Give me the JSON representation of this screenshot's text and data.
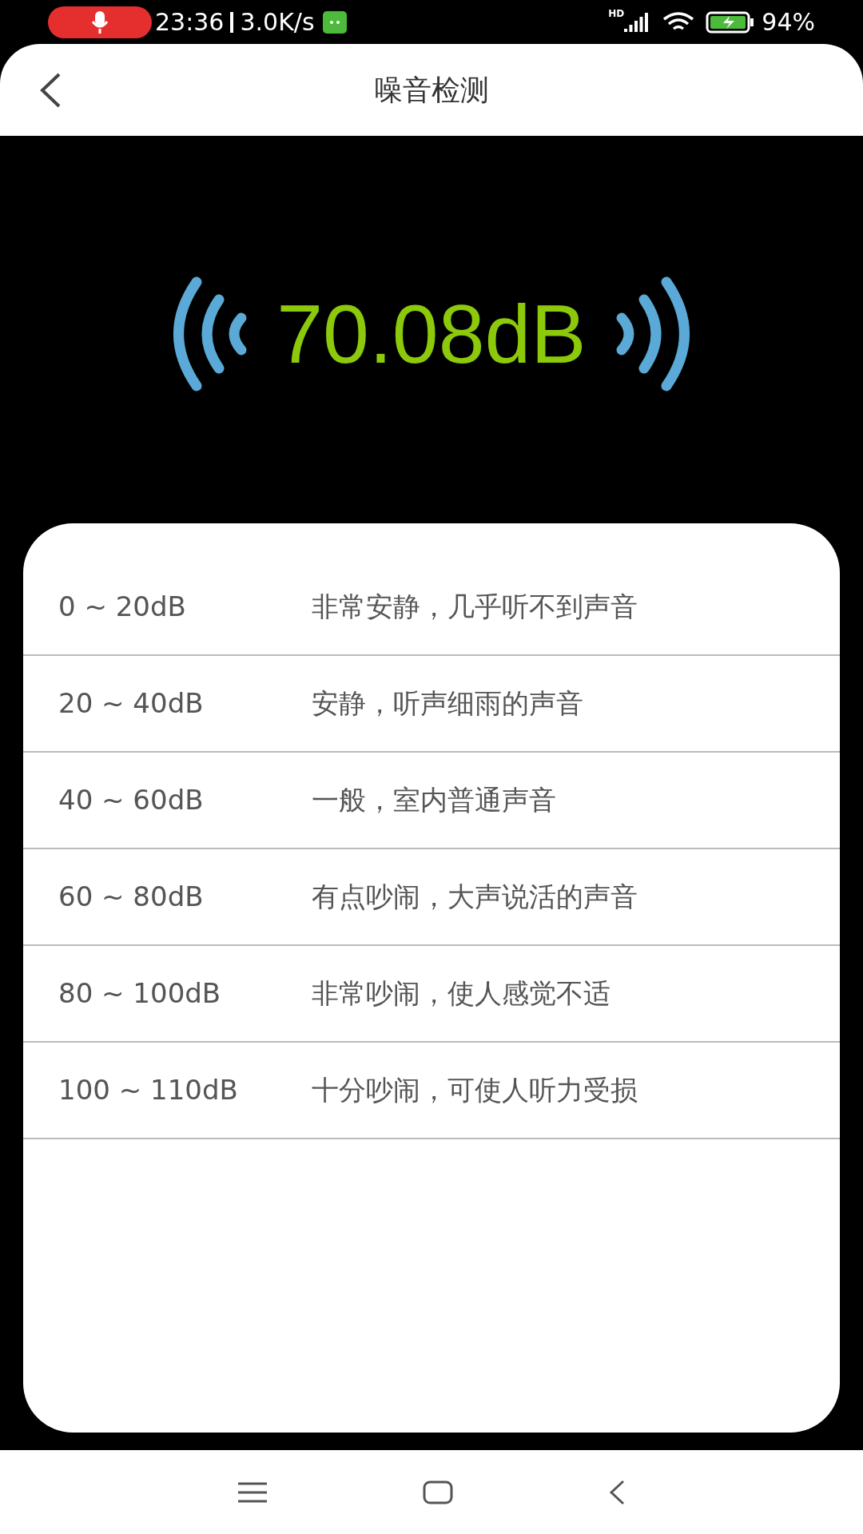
{
  "status_bar": {
    "time": "23:36",
    "speed": "3.0K/s",
    "network_label": "HD",
    "battery": "94%"
  },
  "header": {
    "title": "噪音检测"
  },
  "meter": {
    "reading": "70.08dB"
  },
  "levels": [
    {
      "range": "0 ~ 20dB",
      "description": "非常安静，几乎听不到声音"
    },
    {
      "range": "20 ~ 40dB",
      "description": "安静，听声细雨的声音"
    },
    {
      "range": "40 ~ 60dB",
      "description": "一般，室内普通声音"
    },
    {
      "range": "60 ~ 80dB",
      "description": "有点吵闹，大声说活的声音"
    },
    {
      "range": "80 ~ 100dB",
      "description": "非常吵闹，使人感觉不适"
    },
    {
      "range": "100 ~ 110dB",
      "description": "十分吵闹，可使人听力受损"
    }
  ]
}
